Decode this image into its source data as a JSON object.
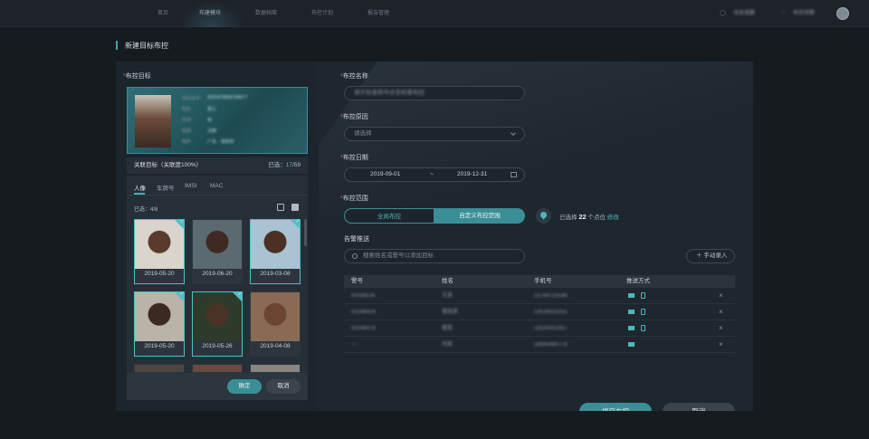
{
  "nav": {
    "items": [
      "首页",
      "布建模块",
      "数据档案",
      "布控计划",
      "报告管理"
    ],
    "active_index": 1,
    "message_label": "消息提醒",
    "alarm_label": "布控预警"
  },
  "page_title": "新建目标布控",
  "left": {
    "target_label": "布控目标",
    "card": {
      "rows": [
        {
          "k": "身份证号",
          "v": "3025478856789677"
        },
        {
          "k": "姓名",
          "v": "张三"
        },
        {
          "k": "性别",
          "v": "男"
        },
        {
          "k": "民族",
          "v": "汉族"
        },
        {
          "k": "籍贯",
          "v": "广东 · 深圳市"
        }
      ]
    },
    "assoc_label": "关联目标（关联度100%）",
    "assoc_selected_prefix": "已选：",
    "assoc_selected_count": "17",
    "assoc_selected_total": "/59",
    "tabs": [
      "人像",
      "车牌号",
      "IMSI",
      "MAC"
    ],
    "active_tab": 0,
    "gallery_selected": "已选：4/8",
    "thumbs": [
      {
        "date": "2019-05-20",
        "selected": true
      },
      {
        "date": "2019-06-20",
        "selected": false
      },
      {
        "date": "2019-03-08",
        "selected": true
      },
      {
        "date": "2019-05-20",
        "selected": true
      },
      {
        "date": "2019-05-26",
        "selected": true
      },
      {
        "date": "2019-04-08",
        "selected": false
      }
    ],
    "confirm_label": "确定",
    "cancel_label": "取消"
  },
  "right": {
    "name_label": "布控名称",
    "name_placeholder": "请于标准库中点击检索布控",
    "reason_label": "布控原因",
    "reason_placeholder": "请选择",
    "date_label": "布控日期",
    "date_start": "2019-09-01",
    "date_sep": "~",
    "date_end": "2019-12-31",
    "range_label": "布控范围",
    "range_options": [
      "全局布控",
      "自定义布控范围"
    ],
    "range_active": 1,
    "point_prefix": "已选择",
    "point_count": "22",
    "point_suffix": "个点位",
    "point_edit": "修改",
    "alarm_label": "告警推送",
    "search_placeholder": "搜索姓名或警号以添加目标",
    "manual_add": "手动录入",
    "table": {
      "headers": [
        "警号",
        "姓名",
        "手机号",
        "推送方式"
      ],
      "rows": [
        {
          "id": "00298535",
          "name": "王某",
          "phone": "15784725588",
          "mail": true,
          "phone_icon": true
        },
        {
          "id": "00298404",
          "name": "黄国某",
          "phone": "14538533255",
          "mail": true,
          "phone_icon": true
        },
        {
          "id": "00298478",
          "name": "唐某",
          "phone": "18530032457",
          "mail": true,
          "phone_icon": true
        },
        {
          "id": "---",
          "name": "刘某",
          "phone": "18885484776",
          "mail": true,
          "phone_icon": false
        }
      ]
    },
    "submit_label": "提交布控",
    "cancel_label": "取消"
  }
}
